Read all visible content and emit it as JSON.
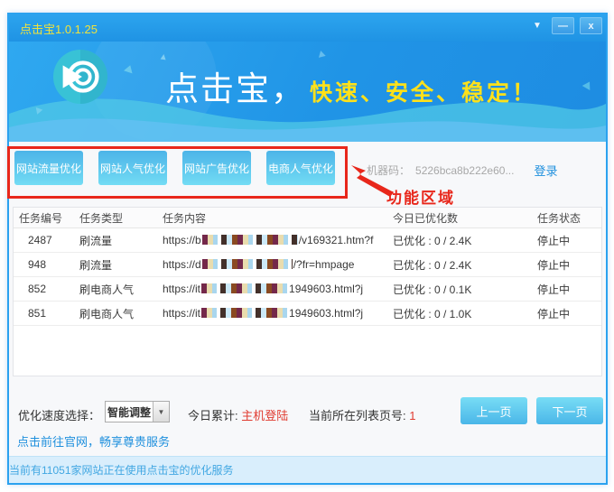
{
  "window": {
    "title": "点击宝1.0.1.25",
    "controls": {
      "menu": "▼",
      "minimize": "—",
      "close": "x"
    }
  },
  "banner": {
    "brand": "点击宝，",
    "slogan": "快速、安全、稳定！"
  },
  "features": {
    "buttons": [
      {
        "label": "网站流量优化"
      },
      {
        "label": "网站人气优化"
      },
      {
        "label": "网站广告优化"
      },
      {
        "label": "电商人气优化"
      }
    ],
    "annotation": "功能区域"
  },
  "machine": {
    "label": "机器码：",
    "code": "5226bca8b222e60...",
    "login": "登录"
  },
  "table": {
    "headers": [
      "任务编号",
      "任务类型",
      "任务内容",
      "今日已优化数",
      "任务状态"
    ],
    "rows": [
      {
        "id": "2487",
        "type": "刷流量",
        "url_prefix": "https://b",
        "url_suffix": "/v169321.htm?f",
        "mask_width": 106,
        "optimized": "已优化 : 0 / 2.4K",
        "status": "停止中"
      },
      {
        "id": "948",
        "type": "刷流量",
        "url_prefix": "https://d",
        "url_suffix": "/?fr=hmpage",
        "mask_width": 100,
        "optimized": "已优化 : 0 / 2.4K",
        "status": "停止中"
      },
      {
        "id": "852",
        "type": "刷电商人气",
        "url_prefix": "https://it",
        "url_suffix": "1949603.html?j",
        "mask_width": 96,
        "optimized": "已优化 : 0 / 0.1K",
        "status": "停止中"
      },
      {
        "id": "851",
        "type": "刷电商人气",
        "url_prefix": "https://it",
        "url_suffix": "1949603.html?j",
        "mask_width": 96,
        "optimized": "已优化 : 0 / 1.0K",
        "status": "停止中"
      }
    ]
  },
  "controls": {
    "speed_label": "优化速度选择：",
    "speed_value": "智能调整",
    "today_label": "今日累计:",
    "today_value": "主机登陆",
    "page_label": "当前所在列表页号:",
    "page_value": "1",
    "prev_label": "上一页",
    "next_label": "下一页"
  },
  "footer_link": "点击前往官网，畅享尊贵服务",
  "statusbar": {
    "prefix": "当前有",
    "count": "11051",
    "suffix": "家网站正在使用点击宝的优化服务"
  },
  "colors": {
    "accent_blue": "#2ba2ef",
    "button_cyan": "#55c8ee",
    "annotation_red": "#e8271b",
    "value_red": "#e03a2f",
    "link_blue": "#1e8fdd",
    "title_yellow": "#f0e23c",
    "slogan_yellow": "#ffe11a",
    "statusbar_blue": "#41a7e2"
  }
}
